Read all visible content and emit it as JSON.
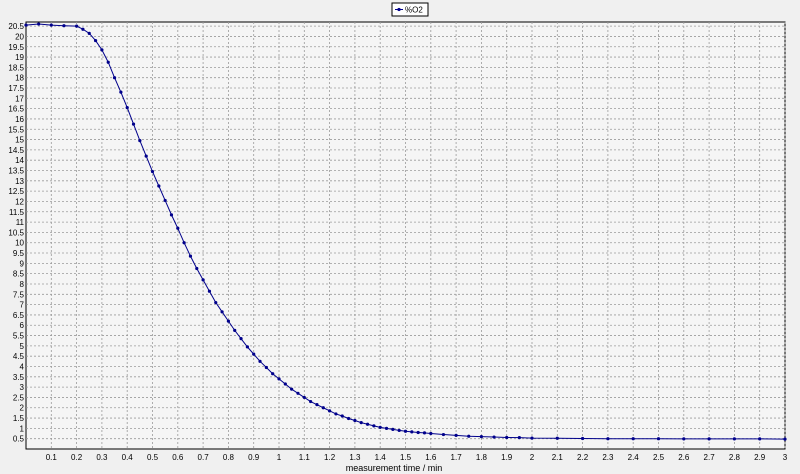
{
  "chart_data": {
    "type": "line",
    "title": "",
    "xlabel": "measurement time / min",
    "ylabel": "",
    "xlim": [
      0.0,
      3.0
    ],
    "ylim": [
      0.0,
      20.7
    ],
    "grid": true,
    "legend_placement": "top-center",
    "x_ticks": [
      0.1,
      0.2,
      0.3,
      0.4,
      0.5,
      0.6,
      0.7,
      0.8,
      0.9,
      1,
      1.1,
      1.2,
      1.3,
      1.4,
      1.5,
      1.6,
      1.7,
      1.8,
      1.9,
      2,
      2.1,
      2.2,
      2.3,
      2.4,
      2.5,
      2.6,
      2.7,
      2.8,
      2.9,
      3
    ],
    "y_ticks": [
      0.5,
      1,
      1.5,
      2,
      2.5,
      3,
      3.5,
      4,
      4.5,
      5,
      5.5,
      6,
      6.5,
      7,
      7.5,
      8,
      8.5,
      9,
      9.5,
      10,
      10.5,
      11,
      11.5,
      12,
      12.5,
      13,
      13.5,
      14,
      14.5,
      15,
      15.5,
      16,
      16.5,
      17,
      17.5,
      18,
      18.5,
      19,
      19.5,
      20,
      20.5
    ],
    "series": [
      {
        "name": "%O2",
        "color": "#00008b",
        "marker": "dot",
        "x": [
          0.0,
          0.05,
          0.1,
          0.15,
          0.2,
          0.225,
          0.25,
          0.275,
          0.3,
          0.325,
          0.35,
          0.375,
          0.4,
          0.425,
          0.45,
          0.475,
          0.5,
          0.525,
          0.55,
          0.575,
          0.6,
          0.625,
          0.65,
          0.675,
          0.7,
          0.725,
          0.75,
          0.775,
          0.8,
          0.825,
          0.85,
          0.875,
          0.9,
          0.925,
          0.95,
          0.975,
          1.0,
          1.025,
          1.05,
          1.075,
          1.1,
          1.125,
          1.15,
          1.175,
          1.2,
          1.225,
          1.25,
          1.275,
          1.3,
          1.325,
          1.35,
          1.375,
          1.4,
          1.425,
          1.45,
          1.475,
          1.5,
          1.525,
          1.55,
          1.575,
          1.6,
          1.65,
          1.7,
          1.75,
          1.8,
          1.85,
          1.9,
          1.95,
          2.0,
          2.1,
          2.2,
          2.3,
          2.4,
          2.5,
          2.6,
          2.7,
          2.8,
          2.9,
          3.0
        ],
        "values": [
          20.55,
          20.6,
          20.55,
          20.52,
          20.5,
          20.35,
          20.15,
          19.8,
          19.35,
          18.75,
          18.0,
          17.3,
          16.55,
          15.75,
          14.95,
          14.2,
          13.45,
          12.75,
          12.05,
          11.35,
          10.7,
          10.0,
          9.35,
          8.75,
          8.2,
          7.65,
          7.1,
          6.65,
          6.2,
          5.75,
          5.35,
          4.95,
          4.6,
          4.25,
          3.95,
          3.65,
          3.4,
          3.15,
          2.9,
          2.7,
          2.5,
          2.3,
          2.15,
          2.0,
          1.85,
          1.7,
          1.6,
          1.48,
          1.38,
          1.28,
          1.2,
          1.12,
          1.05,
          1.0,
          0.95,
          0.9,
          0.86,
          0.83,
          0.8,
          0.78,
          0.75,
          0.7,
          0.66,
          0.62,
          0.6,
          0.58,
          0.56,
          0.55,
          0.53,
          0.52,
          0.51,
          0.5,
          0.5,
          0.5,
          0.49,
          0.49,
          0.49,
          0.49,
          0.48
        ]
      }
    ]
  }
}
